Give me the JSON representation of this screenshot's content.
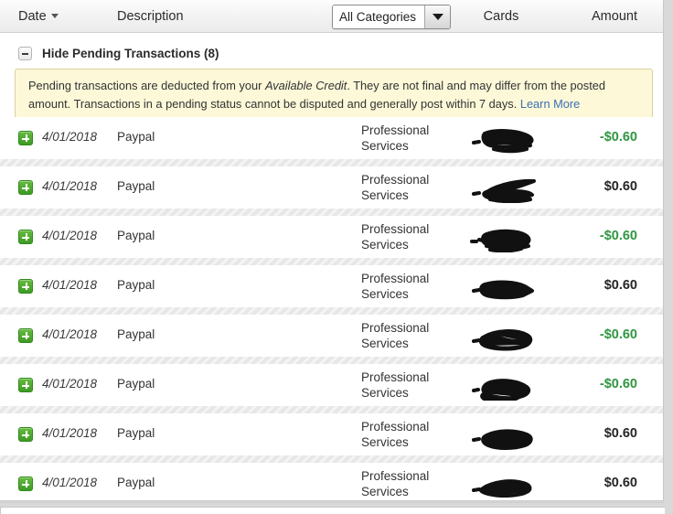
{
  "table": {
    "columns": {
      "date": "Date",
      "description": "Description",
      "cards": "Cards",
      "amount": "Amount"
    },
    "sort_icon": "chevron-down-icon",
    "sort_column": "Date"
  },
  "category_filter": {
    "selected": "All Categories",
    "caret_icon": "chevron-down-icon"
  },
  "pending_section": {
    "toggle_icon": "minus-icon",
    "toggle_label": "Hide Pending Transactions (8)",
    "count": 8,
    "expanded": true
  },
  "notice": {
    "text_part1": "Pending transactions are deducted from your ",
    "emphasis": "Available Credit",
    "text_part2": ". They are not final and may differ from the posted amount. Transactions in a pending status cannot be disputed and generally post within 7 days. ",
    "link_label": "Learn More",
    "background_color": "#fcf8d8",
    "border_color": "#dcd09f",
    "link_color": "#3c6fb4"
  },
  "colors": {
    "negative_amount": "#2f9640",
    "positive_amount": "#262626",
    "expand_button": "#3f9a24",
    "page_background": "#d9d9d9",
    "panel_background": "#ffffff",
    "row_separator": "#e7e7e7"
  },
  "transactions": [
    {
      "expand_icon": "plus-icon",
      "date": "4/01/2018",
      "description": "Paypal",
      "category": "Professional Services",
      "card": "redacted-scribble",
      "amount": "-$0.60",
      "amount_sign": "negative"
    },
    {
      "expand_icon": "plus-icon",
      "date": "4/01/2018",
      "description": "Paypal",
      "category": "Professional Services",
      "card": "redacted-scribble",
      "amount": "$0.60",
      "amount_sign": "positive"
    },
    {
      "expand_icon": "plus-icon",
      "date": "4/01/2018",
      "description": "Paypal",
      "category": "Professional Services",
      "card": "redacted-scribble",
      "amount": "-$0.60",
      "amount_sign": "negative"
    },
    {
      "expand_icon": "plus-icon",
      "date": "4/01/2018",
      "description": "Paypal",
      "category": "Professional Services",
      "card": "redacted-scribble",
      "amount": "$0.60",
      "amount_sign": "positive"
    },
    {
      "expand_icon": "plus-icon",
      "date": "4/01/2018",
      "description": "Paypal",
      "category": "Professional Services",
      "card": "redacted-scribble",
      "amount": "-$0.60",
      "amount_sign": "negative"
    },
    {
      "expand_icon": "plus-icon",
      "date": "4/01/2018",
      "description": "Paypal",
      "category": "Professional Services",
      "card": "redacted-scribble",
      "amount": "-$0.60",
      "amount_sign": "negative"
    },
    {
      "expand_icon": "plus-icon",
      "date": "4/01/2018",
      "description": "Paypal",
      "category": "Professional Services",
      "card": "redacted-scribble",
      "amount": "$0.60",
      "amount_sign": "positive"
    },
    {
      "expand_icon": "plus-icon",
      "date": "4/01/2018",
      "description": "Paypal",
      "category": "Professional Services",
      "card": "redacted-scribble",
      "amount": "$0.60",
      "amount_sign": "positive"
    }
  ]
}
